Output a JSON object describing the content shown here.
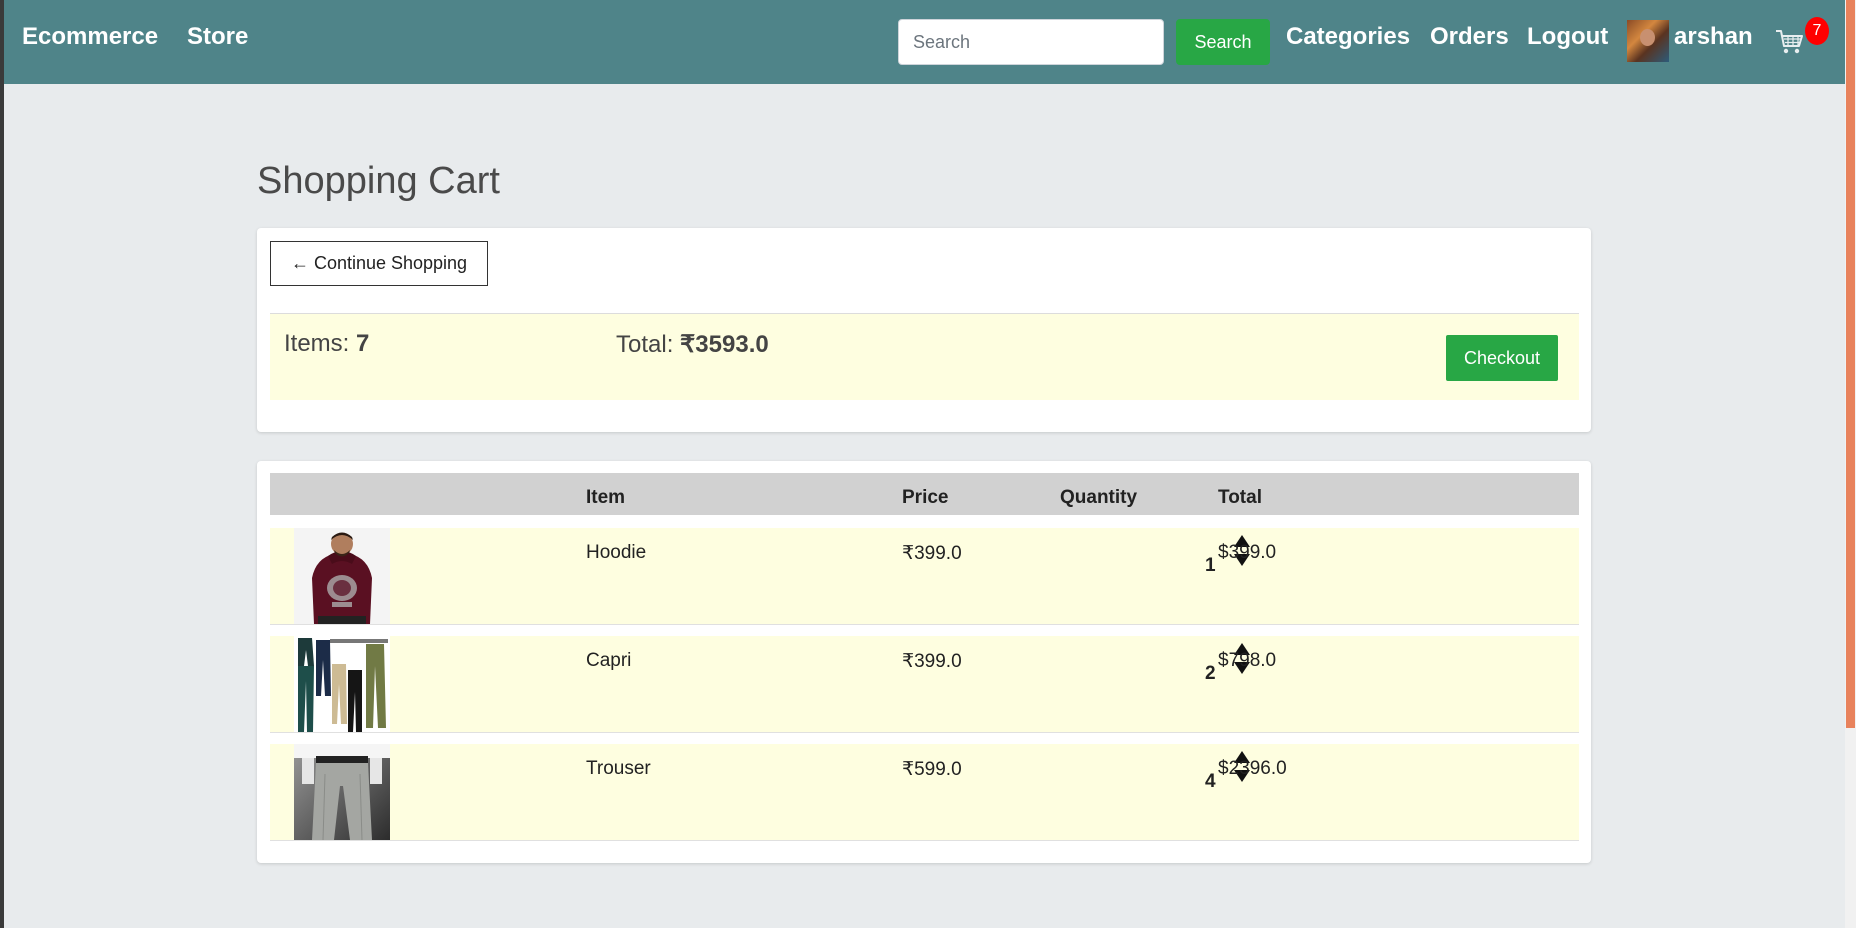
{
  "nav": {
    "brand": "Ecommerce",
    "store": "Store",
    "search_placeholder": "Search",
    "search_button": "Search",
    "categories": "Categories",
    "orders": "Orders",
    "logout": "Logout",
    "username": "arshan",
    "cart_count": "7"
  },
  "page": {
    "title": "Shopping Cart"
  },
  "summary": {
    "continue_label": "← Continue Shopping",
    "items_label": "Items: ",
    "items_value": "7",
    "total_label": "Total: ",
    "total_value": "₹3593.0",
    "checkout_label": "Checkout"
  },
  "table": {
    "headers": {
      "item": "Item",
      "price": "Price",
      "quantity": "Quantity",
      "total": "Total"
    },
    "rows": [
      {
        "name": "Hoodie",
        "price": "₹399.0",
        "quantity": "1",
        "total": "$399.0",
        "image": "hoodie-product-image"
      },
      {
        "name": "Capri",
        "price": "₹399.0",
        "quantity": "2",
        "total": "$798.0",
        "image": "capri-product-image"
      },
      {
        "name": "Trouser",
        "price": "₹599.0",
        "quantity": "4",
        "total": "$2396.0",
        "image": "trouser-product-image"
      }
    ]
  },
  "colors": {
    "navbar": "#4f8489",
    "success": "#28a745",
    "highlight_row": "#fefee0",
    "table_header": "#d1d1d1",
    "badge": "#ff0000"
  }
}
